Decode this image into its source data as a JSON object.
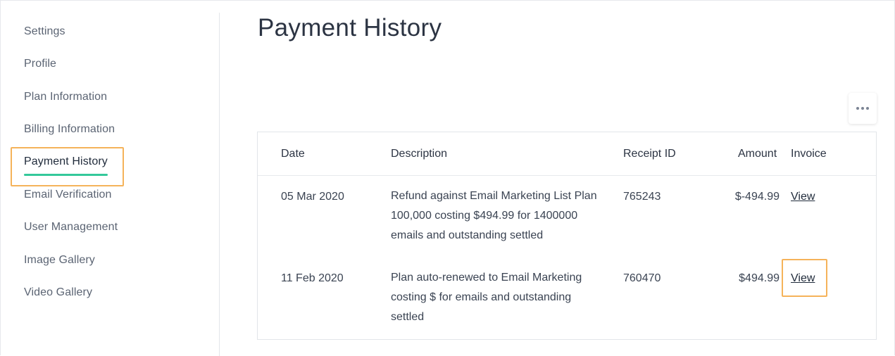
{
  "sidebar": {
    "items": [
      {
        "label": "Settings"
      },
      {
        "label": "Profile"
      },
      {
        "label": "Plan Information"
      },
      {
        "label": "Billing Information"
      },
      {
        "label": "Payment History"
      },
      {
        "label": "Email Verification"
      },
      {
        "label": "User Management"
      },
      {
        "label": "Image Gallery"
      },
      {
        "label": "Video Gallery"
      }
    ],
    "active_index": 4
  },
  "page": {
    "title": "Payment History"
  },
  "table": {
    "columns": [
      "Date",
      "Description",
      "Receipt ID",
      "Amount",
      "Invoice"
    ],
    "rows": [
      {
        "date": "05 Mar 2020",
        "description": "Refund against Email Marketing List Plan 100,000 costing $494.99 for 1400000 emails and outstanding settled",
        "receipt_id": "765243",
        "amount": "$-494.99",
        "invoice": "View"
      },
      {
        "date": "11 Feb 2020",
        "description": "Plan auto-renewed to Email Marketing costing $ for emails and outstanding settled",
        "receipt_id": "760470",
        "amount": "$494.99",
        "invoice": "View"
      }
    ]
  },
  "colors": {
    "active_underline": "#34c89a",
    "highlight_box": "#f5b35a",
    "text": "#2c3443"
  },
  "icons": {
    "more_menu": "more-horizontal-icon"
  }
}
